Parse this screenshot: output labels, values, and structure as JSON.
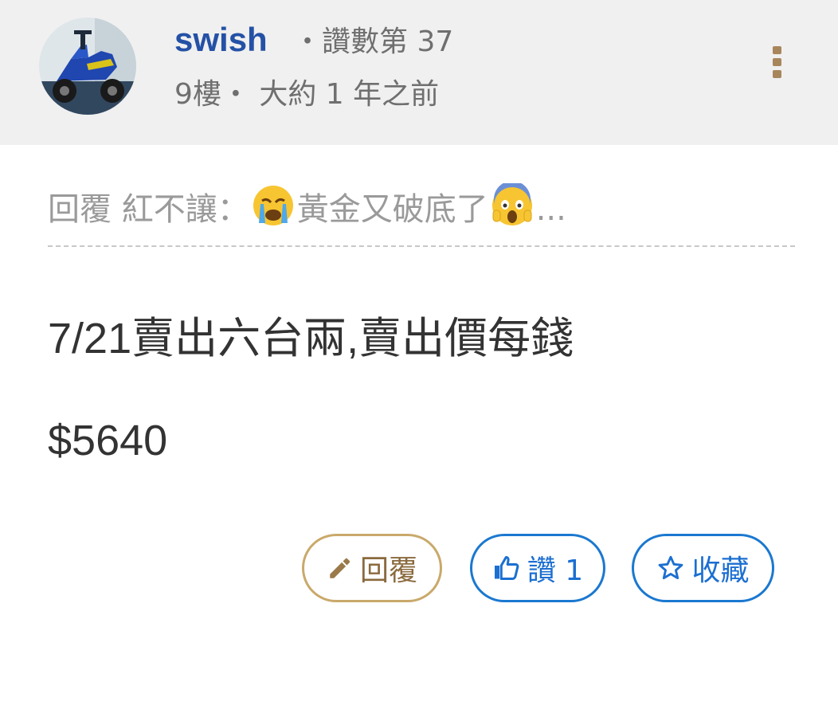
{
  "post": {
    "author": {
      "name": "swish",
      "likes_label": "・讚數第 37",
      "avatar_icon": "scooter-avatar-icon"
    },
    "floor_label": "9樓・",
    "time_label": "大約 1 年之前",
    "more_icon": "more-vertical-icon",
    "quote": {
      "prefix": "回覆 紅不讓：",
      "emoji1": "crying-face-emoji",
      "text": "黃金又破底了",
      "emoji2": "screaming-face-emoji",
      "suffix": "..."
    },
    "body": {
      "line1": "7/21賣出六台兩,賣出價每錢",
      "line2": "$5640"
    },
    "actions": {
      "reply_label": "回覆",
      "like_label": "讚 1",
      "favorite_label": "收藏"
    }
  },
  "colors": {
    "username": "#2451a6",
    "reply_border": "#c9a96b",
    "action_blue": "#1b78d0",
    "header_bg": "#f0f0f0"
  }
}
